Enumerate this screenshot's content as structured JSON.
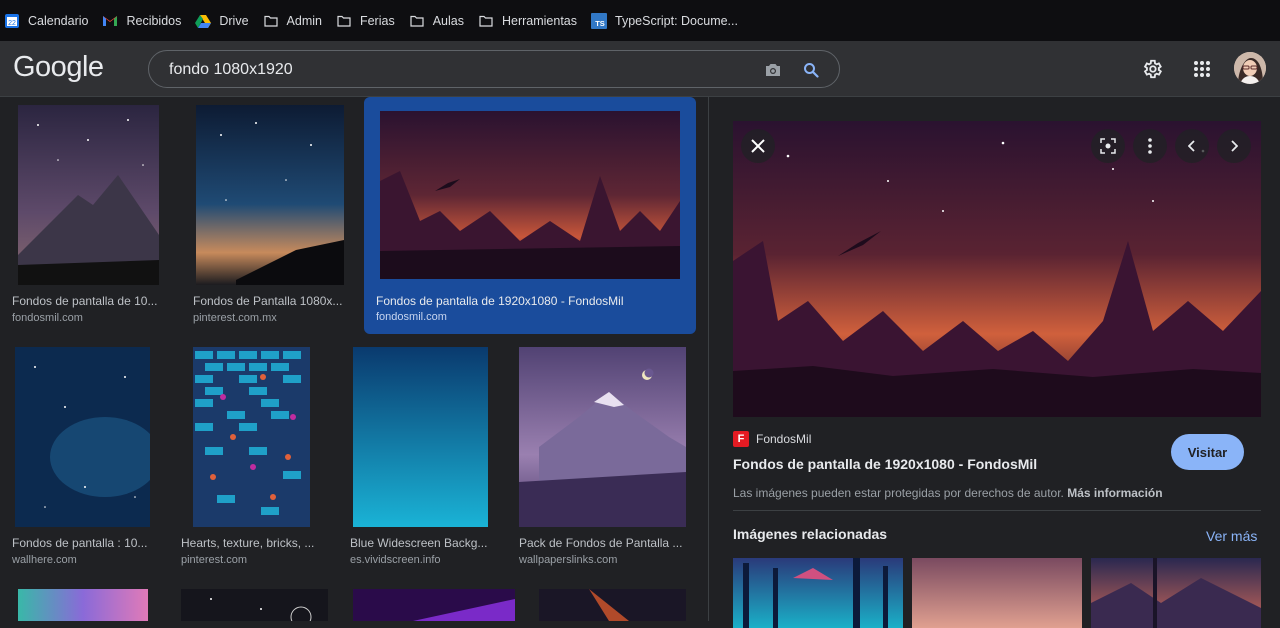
{
  "bookmarks": [
    {
      "label": "Calendario",
      "icon": "calendar-icon"
    },
    {
      "label": "Recibidos",
      "icon": "gmail-icon"
    },
    {
      "label": "Drive",
      "icon": "drive-icon"
    },
    {
      "label": "Admin",
      "icon": "folder-icon"
    },
    {
      "label": "Ferias",
      "icon": "folder-icon"
    },
    {
      "label": "Aulas",
      "icon": "folder-icon"
    },
    {
      "label": "Herramientas",
      "icon": "folder-icon"
    },
    {
      "label": "TypeScript: Docume...",
      "icon": "typescript-icon"
    }
  ],
  "calendar_badge": "22",
  "ts_badge": "TS",
  "header": {
    "logo": "Google",
    "search_value": "fondo 1080x1920",
    "icons": [
      "camera-icon",
      "search-icon",
      "gear-icon",
      "apps-grid-icon"
    ]
  },
  "results": [
    {
      "title": "Fondos de pantalla de 10...",
      "source": "fondosmil.com"
    },
    {
      "title": "Fondos de Pantalla 1080x...",
      "source": "pinterest.com.mx"
    },
    {
      "title": "Fondos de pantalla de 1920x1080 - FondosMil",
      "source": "fondosmil.com"
    },
    {
      "title": "Fondos de pantalla : 10...",
      "source": "wallhere.com"
    },
    {
      "title": "Hearts, texture, bricks, ...",
      "source": "pinterest.com"
    },
    {
      "title": "Blue Widescreen Backg...",
      "source": "es.vividscreen.info"
    },
    {
      "title": "Pack de Fondos de Pantalla ...",
      "source": "wallpaperslinks.com"
    }
  ],
  "panel": {
    "source_logo": "F",
    "source_name": "FondosMil",
    "title": "Fondos de pantalla de 1920x1080 - FondosMil",
    "visit_label": "Visitar",
    "copyright_text": "Las imágenes pueden estar protegidas por derechos de autor.",
    "copyright_link": "Más información",
    "related_title": "Imágenes relacionadas",
    "more_label": "Ver más"
  },
  "colors": {
    "accent": "#8ab4f8",
    "selected_bg": "#1a4c9c",
    "page_bg": "#202124"
  }
}
